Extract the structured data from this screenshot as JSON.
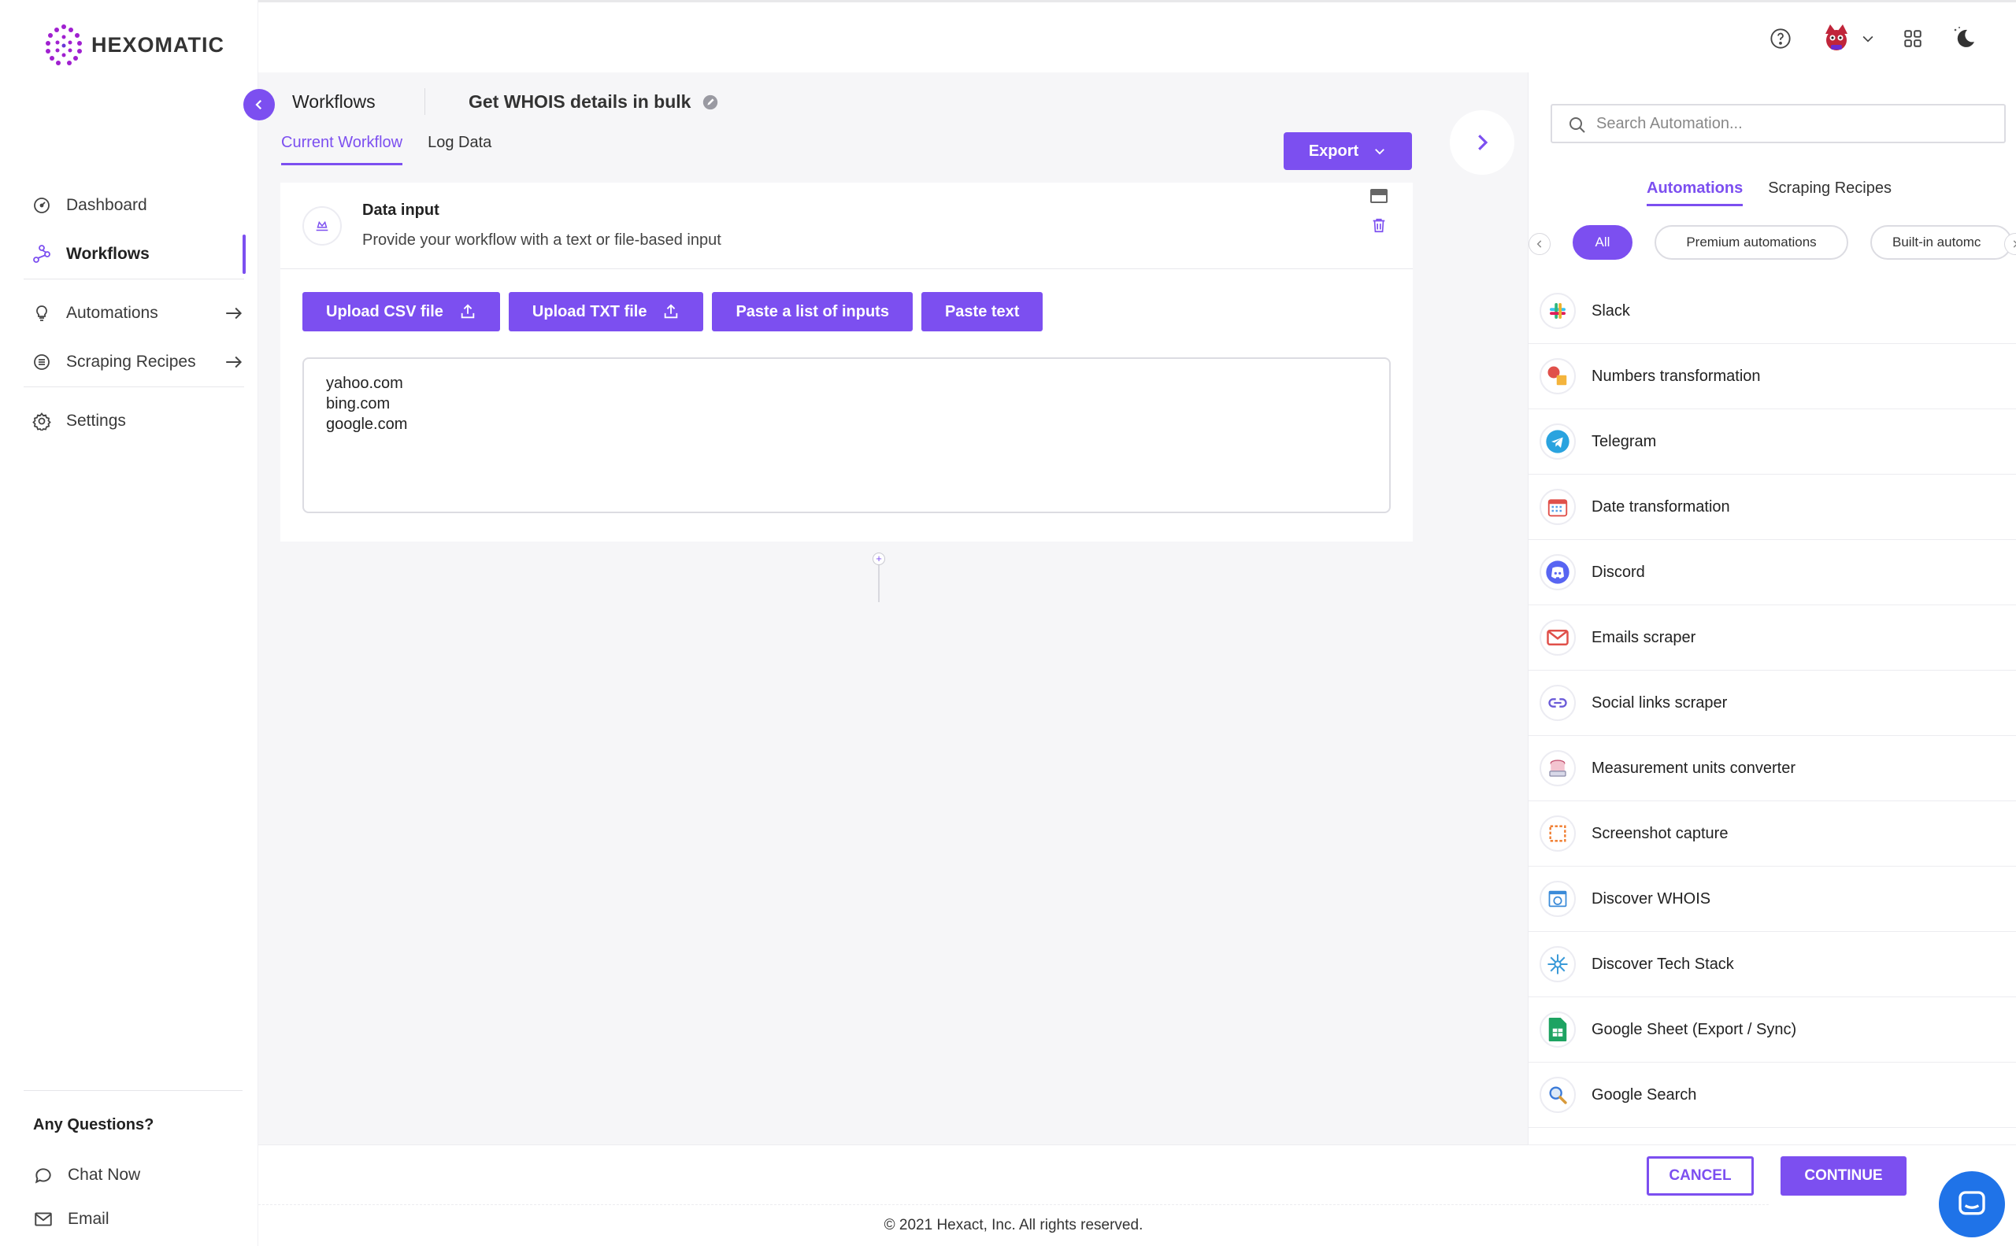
{
  "brand": {
    "name": "HEXOMATIC",
    "accent": "#7c4ff0"
  },
  "sidebar": {
    "items": [
      {
        "label": "Dashboard",
        "icon": "dashboard-icon"
      },
      {
        "label": "Workflows",
        "icon": "workflows-icon",
        "active": true
      },
      {
        "label": "Automations",
        "icon": "bulb-icon",
        "arrow": true
      },
      {
        "label": "Scraping Recipes",
        "icon": "list-icon",
        "arrow": true
      },
      {
        "label": "Settings",
        "icon": "gear-icon"
      }
    ],
    "help": {
      "title": "Any Questions?",
      "chat_label": "Chat Now",
      "email_label": "Email"
    }
  },
  "header": {
    "breadcrumb": "Workflows",
    "workflow_name": "Get WHOIS details in bulk",
    "tabs": [
      {
        "label": "Current Workflow",
        "active": true
      },
      {
        "label": "Log Data"
      }
    ],
    "export_label": "Export"
  },
  "data_input": {
    "title": "Data input",
    "subtitle": "Provide your workflow with a text or file-based input",
    "buttons": {
      "upload_csv": "Upload CSV file",
      "upload_txt": "Upload TXT file",
      "paste_list": "Paste a list of inputs",
      "paste_text": "Paste text"
    },
    "textarea_value": "yahoo.com\nbing.com\ngoogle.com"
  },
  "right_panel": {
    "search_placeholder": "Search Automation...",
    "tabs": [
      {
        "label": "Automations",
        "active": true
      },
      {
        "label": "Scraping Recipes"
      }
    ],
    "chips": [
      {
        "label": "All",
        "active": true
      },
      {
        "label": "Premium automations"
      },
      {
        "label": "Built-in automc"
      }
    ],
    "automations": [
      {
        "label": "Slack",
        "icon": "slack-icon"
      },
      {
        "label": "Numbers transformation",
        "icon": "numbers-icon"
      },
      {
        "label": "Telegram",
        "icon": "telegram-icon"
      },
      {
        "label": "Date transformation",
        "icon": "calendar-icon"
      },
      {
        "label": "Discord",
        "icon": "discord-icon"
      },
      {
        "label": "Emails scraper",
        "icon": "email-icon"
      },
      {
        "label": "Social links scraper",
        "icon": "link-icon"
      },
      {
        "label": "Measurement units converter",
        "icon": "scale-icon"
      },
      {
        "label": "Screenshot capture",
        "icon": "screenshot-icon"
      },
      {
        "label": "Discover WHOIS",
        "icon": "whois-icon"
      },
      {
        "label": "Discover Tech Stack",
        "icon": "tech-stack-icon"
      },
      {
        "label": "Google Sheet (Export / Sync)",
        "icon": "google-sheet-icon"
      },
      {
        "label": "Google Search",
        "icon": "magnifier-icon"
      }
    ]
  },
  "actions": {
    "cancel_label": "CANCEL",
    "continue_label": "CONTINUE"
  },
  "footer": {
    "copyright": "© 2021 Hexact, Inc. All rights reserved."
  }
}
